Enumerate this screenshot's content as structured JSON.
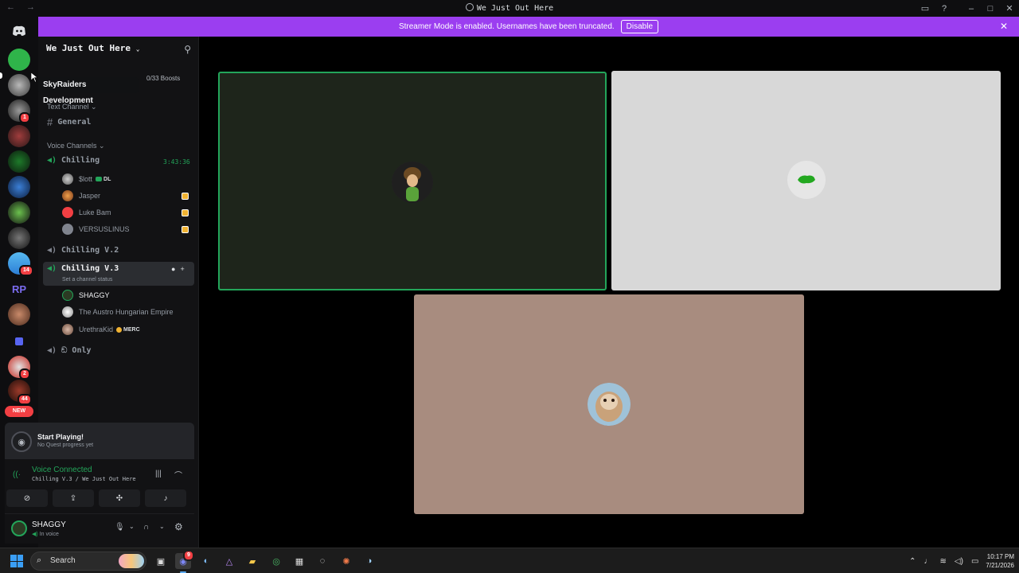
{
  "window": {
    "title": "We Just Out Here"
  },
  "banner": {
    "message": "Streamer Mode is enabled. Usernames have been truncated.",
    "disable_label": "Disable"
  },
  "tooltip": "SkyRaiders Development",
  "guilds": {
    "new_label": "NEW",
    "badges": [
      "1",
      "14",
      "2",
      "44"
    ]
  },
  "server": {
    "name": "We Just Out Here",
    "boosts": "0/33 Boosts"
  },
  "categories": {
    "text": "Text Channel",
    "voice": "Voice Channels"
  },
  "channels": {
    "general": "General",
    "chilling": "Chilling",
    "chilling_time": "3:43:36",
    "chilling2": "Chilling V.2",
    "chilling3": "Chilling V.3",
    "chilling3_status": "Set a channel status",
    "only": "ඞ Only"
  },
  "voice_users_chilling": [
    {
      "name": "$lott",
      "tag": "DL"
    },
    {
      "name": "Jasper"
    },
    {
      "name": "Luke Bam"
    },
    {
      "name": "VERSUSLINUS"
    }
  ],
  "voice_users_chilling3": [
    {
      "name": "SHAGGY"
    },
    {
      "name": "The Austro Hungarian Empire"
    },
    {
      "name": "UrethraKid",
      "tag": "MERC"
    }
  ],
  "quest": {
    "title": "Start Playing!",
    "subtitle": "No Quest progress yet"
  },
  "voice_panel": {
    "status": "Voice Connected",
    "location": "Chilling V.3 / We Just Out Here"
  },
  "user": {
    "name": "SHAGGY",
    "status": "In voice"
  },
  "taskbar": {
    "search_label": "Search",
    "discord_badge": "9",
    "time": "10:17 PM",
    "date": "7/21/2026"
  },
  "colors": {
    "accent_banner": "#9b3ef0",
    "voice_green": "#23a55a",
    "badge_red": "#f23f43"
  }
}
